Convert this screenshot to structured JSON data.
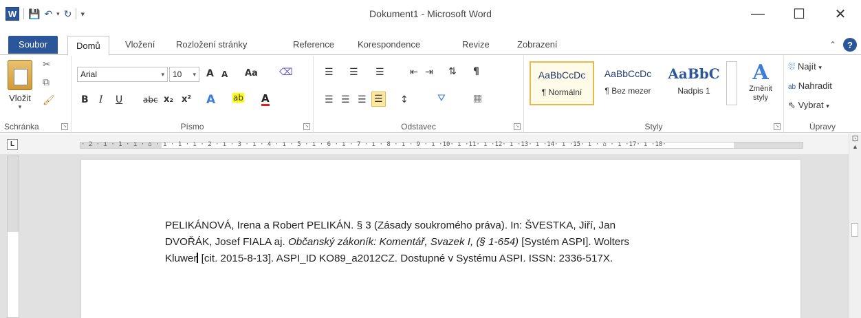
{
  "window": {
    "title": "Dokument1 - Microsoft Word",
    "minimize": "—",
    "maximize": "☐",
    "close": "✕"
  },
  "tabs": {
    "file": "Soubor",
    "home": "Domů",
    "insert": "Vložení",
    "layout": "Rozložení stránky",
    "references": "Reference",
    "mailings": "Korespondence",
    "review": "Revize",
    "view": "Zobrazení",
    "help": "?"
  },
  "ribbon": {
    "clipboard": {
      "paste": "Vložit",
      "label": "Schránka"
    },
    "font": {
      "name": "Arial",
      "size": "10",
      "grow": "A",
      "shrink": "A",
      "case": "Aa",
      "bold": "B",
      "italic": "I",
      "underline": "U",
      "strike": "abc",
      "subscript": "x₂",
      "superscript": "x²",
      "highlight": "ab",
      "color": "A",
      "label": "Písmo"
    },
    "paragraph": {
      "label": "Odstavec",
      "pilcrow": "¶"
    },
    "styles": {
      "items": [
        {
          "preview": "AaBbCcDc",
          "name": "¶ Normální"
        },
        {
          "preview": "AaBbCcDc",
          "name": "¶ Bez mezer"
        },
        {
          "preview": "AaBbC",
          "name": "Nadpis 1"
        }
      ],
      "change": "Změnit styly",
      "label": "Styly"
    },
    "editing": {
      "find": "Najít",
      "replace": "Nahradit",
      "select": "Vybrat",
      "label": "Úpravy"
    }
  },
  "ruler": {
    "numbers": "· 2 · ı · 1 · ı · ⌂ · ı · 1 · ı · 2 · ı · 3 · ı · 4 · ı · 5 · ı · 6 · ı · 7 · ı · 8 · ı · 9 · ı ·10· ı ·11· ı ·12· ı ·13· ı ·14· ı ·15· ı · ⌂ · ı ·17· ı ·18·",
    "tab_marker": "L"
  },
  "document": {
    "line1": "PELIKÁNOVÁ, Irena a Robert PELIKÁN. § 3 (Zásady soukromého práva). In: ŠVESTKA, Jiří, Jan",
    "line2_a": "DVOŘÁK, Josef FIALA aj. ",
    "line2_italic": "Občanský zákoník: Komentář, Svazek I, (§ 1-654)",
    "line2_b": " [Systém ASPI].  Wolters",
    "line3_a": "Kluwer",
    "line3_b": " [cit. 2015-8-13].  ASPI_ID KO89_a2012CZ.  Dostupné v Systému ASPI. ISSN: 2336-517X."
  }
}
